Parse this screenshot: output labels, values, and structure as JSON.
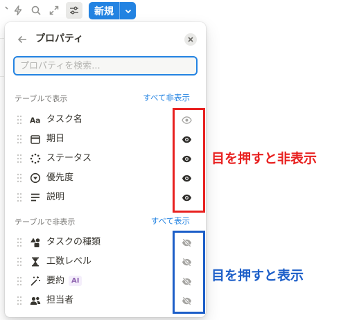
{
  "toolbar": {
    "icons": [
      "filter-icon",
      "bolt-icon",
      "search-icon",
      "expand-icon",
      "sliders-icon"
    ],
    "new_button_label": "新規"
  },
  "panel": {
    "title": "プロパティ",
    "search_placeholder": "プロパティを検索...",
    "shown_section": {
      "label": "テーブルで表示",
      "action": "すべて非表示",
      "items": [
        {
          "label": "タスク名",
          "icon": "text-aa-icon",
          "eye": "visible-disabled"
        },
        {
          "label": "期日",
          "icon": "calendar-icon",
          "eye": "visible"
        },
        {
          "label": "ステータス",
          "icon": "status-loader-icon",
          "eye": "visible"
        },
        {
          "label": "優先度",
          "icon": "select-circle-icon",
          "eye": "visible"
        },
        {
          "label": "説明",
          "icon": "text-lines-icon",
          "eye": "visible"
        }
      ]
    },
    "hidden_section": {
      "label": "テーブルで非表示",
      "action": "すべて表示",
      "items": [
        {
          "label": "タスクの種類",
          "icon": "shapes-icon",
          "eye": "hidden"
        },
        {
          "label": "工数レベル",
          "icon": "hourglass-icon",
          "eye": "hidden"
        },
        {
          "label": "要約",
          "badge": "AI",
          "icon": "magic-wand-icon",
          "eye": "hidden"
        },
        {
          "label": "担当者",
          "icon": "people-icon",
          "eye": "hidden"
        }
      ]
    }
  },
  "annotations": {
    "red_text": "目を押すと非表示",
    "blue_text": "目を押すと表示",
    "red_color": "#e8201f",
    "blue_color": "#1c5ec8"
  },
  "colors": {
    "accent": "#2383e2"
  }
}
